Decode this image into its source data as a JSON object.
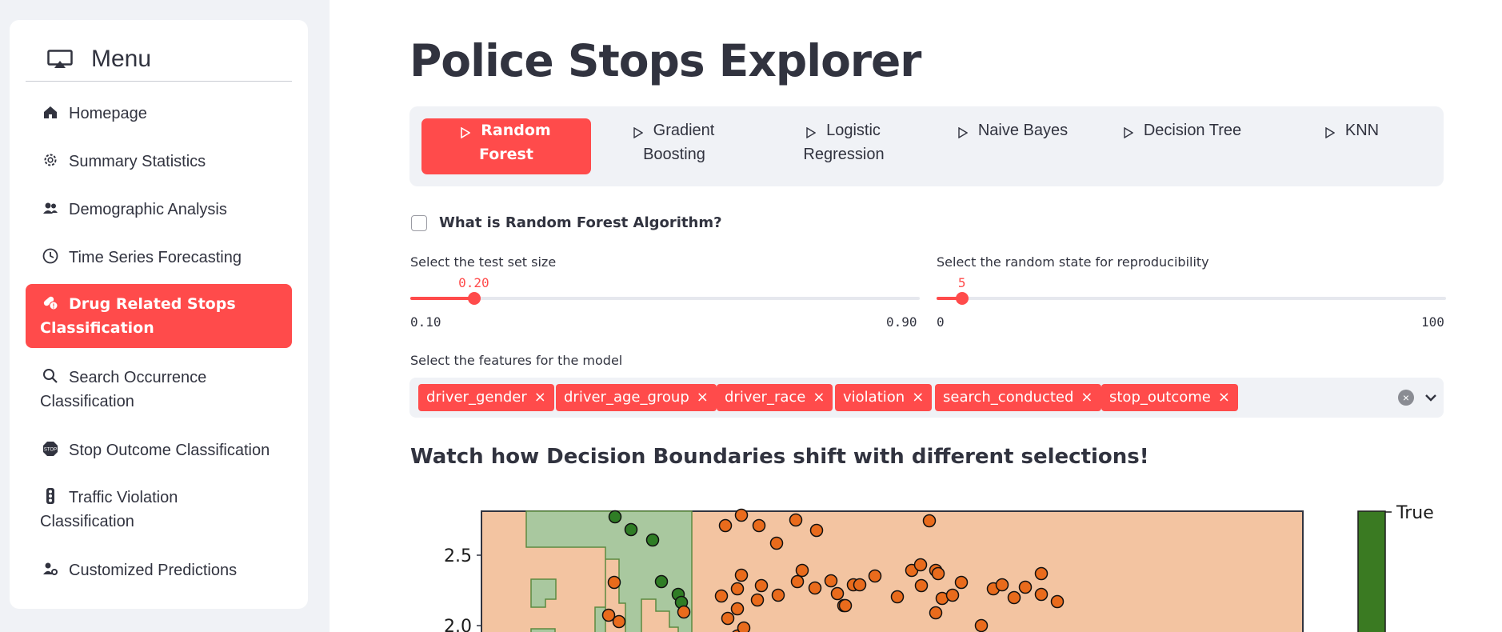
{
  "sidebar": {
    "title": "Menu",
    "items": [
      {
        "label": "Homepage",
        "icon": "house-icon"
      },
      {
        "label": "Summary Statistics",
        "icon": "gear-icon"
      },
      {
        "label": "Demographic Analysis",
        "icon": "people-icon"
      },
      {
        "label": "Time Series Forecasting",
        "icon": "clock-icon"
      },
      {
        "label_line1": "Drug Related Stops",
        "label_line2": "Classification",
        "icon": "capsule-icon",
        "active": true
      },
      {
        "label_line1": "Search Occurrence",
        "label_line2": "Classification",
        "icon": "search-icon"
      },
      {
        "label": "Stop Outcome Classification",
        "icon": "stop-sign-icon"
      },
      {
        "label_line1": "Traffic Violation",
        "label_line2": "Classification",
        "icon": "traffic-light-icon"
      },
      {
        "label": "Customized Predictions",
        "icon": "person-gear-icon"
      }
    ]
  },
  "main": {
    "title": "Police Stops Explorer",
    "tabs": [
      {
        "line1": "Random",
        "line2": "Forest",
        "active": true
      },
      {
        "line1": "Gradient",
        "line2": "Boosting"
      },
      {
        "line1": "Logistic",
        "line2": "Regression"
      },
      {
        "line1": "Naive Bayes"
      },
      {
        "line1": "Decision Tree"
      },
      {
        "line1": "KNN"
      }
    ],
    "checkbox_label": "What is Random Forest Algorithm?",
    "slider_test": {
      "label": "Select the test set size",
      "value": "0.20",
      "min": "0.10",
      "max": "0.90",
      "fraction": 0.125
    },
    "slider_random": {
      "label": "Select the random state for reproducibility",
      "value": "5",
      "min": "0",
      "max": "100",
      "fraction": 0.05
    },
    "features_label": "Select the features for the model",
    "features": [
      "driver_gender",
      "driver_age_group",
      "driver_race",
      "violation",
      "search_conducted",
      "stop_outcome"
    ],
    "chip_remove_symbol": "×",
    "clear_symbol": "×",
    "section_heading": "Watch how Decision Boundaries shift with different selections!",
    "plot": {
      "y_ticks": [
        "2.5",
        "2.0"
      ],
      "colorbar_label": "True"
    }
  },
  "colors": {
    "accent": "#ff4b4b",
    "sidebar_bg": "#f0f2f6",
    "orange_region": "#f3c4a1",
    "green_region": "#a9c89f",
    "orange_point": "#e96b1c",
    "green_point": "#2f7d25",
    "colorbar_green": "#3a7a22"
  }
}
